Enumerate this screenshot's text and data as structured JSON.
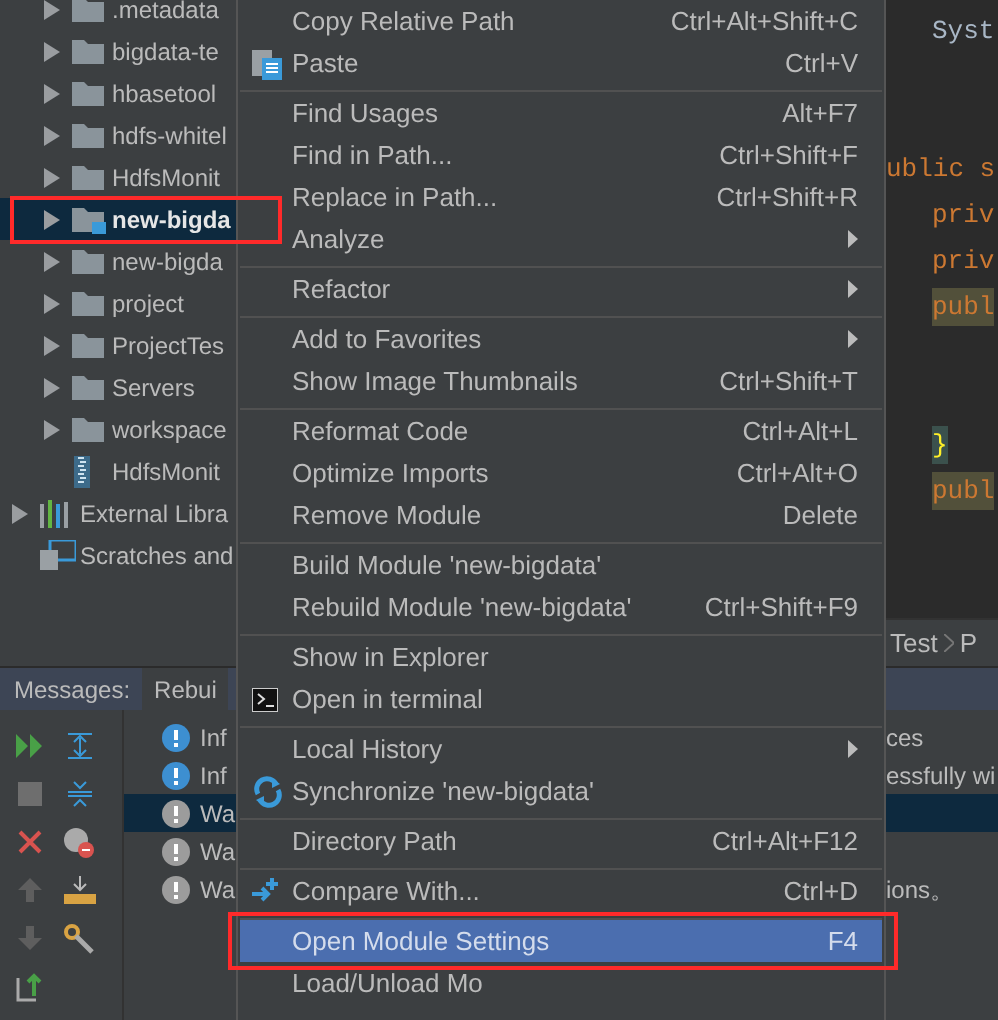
{
  "project_tree": {
    "nested_items": [
      {
        "label": ".metadata",
        "kind": "folder",
        "expandable": true,
        "selected": false
      },
      {
        "label": "bigdata-te",
        "kind": "folder",
        "expandable": true,
        "selected": false
      },
      {
        "label": "hbasetool",
        "kind": "folder",
        "expandable": true,
        "selected": false
      },
      {
        "label": "hdfs-whitel",
        "kind": "folder",
        "expandable": true,
        "selected": false
      },
      {
        "label": "HdfsMonit",
        "kind": "folder",
        "expandable": true,
        "selected": false
      },
      {
        "label": "new-bigda",
        "kind": "module",
        "expandable": true,
        "selected": true
      },
      {
        "label": "new-bigda",
        "kind": "folder",
        "expandable": true,
        "selected": false
      },
      {
        "label": "project",
        "kind": "folder",
        "expandable": true,
        "selected": false
      },
      {
        "label": "ProjectTes",
        "kind": "folder",
        "expandable": true,
        "selected": false
      },
      {
        "label": "Servers",
        "kind": "folder",
        "expandable": true,
        "selected": false
      },
      {
        "label": "workspace",
        "kind": "folder",
        "expandable": true,
        "selected": false
      },
      {
        "label": "HdfsMonit",
        "kind": "file",
        "expandable": false,
        "selected": false
      }
    ],
    "items": [
      {
        "label": "External Libra",
        "kind": "libraries",
        "expandable": true,
        "selected": false
      },
      {
        "label": "Scratches and",
        "kind": "scratches",
        "expandable": false,
        "selected": false
      }
    ]
  },
  "editor": {
    "lines": [
      {
        "text": "Syst",
        "kind": "plain",
        "indented": true,
        "highlighted": false
      },
      {
        "kind": "blank"
      },
      {
        "kind": "blank"
      },
      {
        "text": "ublic s",
        "kind": "keyword",
        "indented": false,
        "highlighted": false
      },
      {
        "text": "priv",
        "kind": "keyword",
        "indented": true,
        "highlighted": false
      },
      {
        "text": "priv",
        "kind": "keyword",
        "indented": true,
        "highlighted": false
      },
      {
        "text": "publ",
        "kind": "keyword",
        "indented": true,
        "highlighted": true
      },
      {
        "kind": "blank"
      },
      {
        "kind": "blank"
      },
      {
        "text": "}",
        "kind": "brace",
        "indented": true,
        "highlighted": true
      },
      {
        "text": "publ",
        "kind": "keyword",
        "indented": true,
        "highlighted": true
      }
    ],
    "breadcrumb": [
      "Test",
      "P"
    ]
  },
  "messages_panel": {
    "title": "Messages:",
    "tabs": [
      {
        "label": "Rebui",
        "selected": true
      }
    ],
    "rows": [
      {
        "kind": "info",
        "text": "Inf",
        "tail": "ces",
        "selected": false
      },
      {
        "kind": "info",
        "text": "Inf",
        "tail": "essfully wi",
        "selected": false
      },
      {
        "kind": "warning",
        "text": "Wa",
        "selected": true
      },
      {
        "kind": "warning",
        "text": "Wa",
        "selected": false
      },
      {
        "kind": "warning",
        "text": "Wa",
        "tail": "ions。",
        "selected": false
      }
    ]
  },
  "context_menu": {
    "items": [
      {
        "label": "Copy Relative Path",
        "shortcut": "Ctrl+Alt+Shift+C",
        "kind": "plain",
        "submenu": false,
        "separator_before": false,
        "selected": false
      },
      {
        "label": "Paste",
        "shortcut": "Ctrl+V",
        "kind": "paste",
        "submenu": false,
        "separator_before": false,
        "selected": false
      },
      {
        "label": "Find Usages",
        "shortcut": "Alt+F7",
        "kind": "plain",
        "submenu": false,
        "separator_before": true,
        "selected": false
      },
      {
        "label": "Find in Path...",
        "shortcut": "Ctrl+Shift+F",
        "kind": "plain",
        "submenu": false,
        "separator_before": false,
        "selected": false
      },
      {
        "label": "Replace in Path...",
        "shortcut": "Ctrl+Shift+R",
        "kind": "plain",
        "submenu": false,
        "separator_before": false,
        "selected": false
      },
      {
        "label": "Analyze",
        "kind": "plain",
        "submenu": true,
        "separator_before": false,
        "selected": false
      },
      {
        "label": "Refactor",
        "kind": "plain",
        "submenu": true,
        "separator_before": true,
        "selected": false
      },
      {
        "label": "Add to Favorites",
        "kind": "plain",
        "submenu": true,
        "separator_before": true,
        "selected": false
      },
      {
        "label": "Show Image Thumbnails",
        "shortcut": "Ctrl+Shift+T",
        "kind": "plain",
        "submenu": false,
        "separator_before": false,
        "selected": false
      },
      {
        "label": "Reformat Code",
        "shortcut": "Ctrl+Alt+L",
        "kind": "plain",
        "submenu": false,
        "separator_before": true,
        "selected": false
      },
      {
        "label": "Optimize Imports",
        "shortcut": "Ctrl+Alt+O",
        "kind": "plain",
        "submenu": false,
        "separator_before": false,
        "selected": false
      },
      {
        "label": "Remove Module",
        "shortcut": "Delete",
        "kind": "plain",
        "submenu": false,
        "separator_before": false,
        "selected": false
      },
      {
        "label": "Build Module 'new-bigdata'",
        "kind": "plain",
        "submenu": false,
        "separator_before": true,
        "selected": false
      },
      {
        "label": "Rebuild Module 'new-bigdata'",
        "shortcut": "Ctrl+Shift+F9",
        "kind": "plain",
        "submenu": false,
        "separator_before": false,
        "selected": false
      },
      {
        "label": "Show in Explorer",
        "kind": "plain",
        "submenu": false,
        "separator_before": true,
        "selected": false
      },
      {
        "label": "Open in terminal",
        "kind": "terminal",
        "submenu": false,
        "separator_before": false,
        "selected": false
      },
      {
        "label": "Local History",
        "kind": "plain",
        "submenu": true,
        "separator_before": true,
        "selected": false
      },
      {
        "label": "Synchronize 'new-bigdata'",
        "kind": "sync",
        "submenu": false,
        "separator_before": false,
        "selected": false
      },
      {
        "label": "Directory Path",
        "shortcut": "Ctrl+Alt+F12",
        "kind": "plain",
        "submenu": false,
        "separator_before": true,
        "selected": false
      },
      {
        "label": "Compare With...",
        "shortcut": "Ctrl+D",
        "kind": "compare",
        "submenu": false,
        "separator_before": true,
        "selected": false
      },
      {
        "label": "Open Module Settings",
        "shortcut": "F4",
        "kind": "plain",
        "submenu": false,
        "separator_before": true,
        "selected": true
      },
      {
        "label": "Load/Unload Mo",
        "kind": "plain",
        "submenu": false,
        "separator_before": false,
        "selected": false
      }
    ]
  }
}
